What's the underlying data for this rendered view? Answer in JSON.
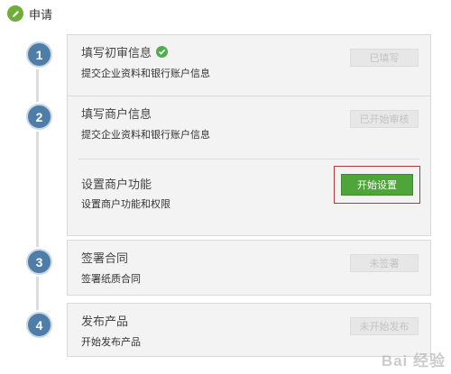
{
  "header": {
    "title": "申请",
    "icon": "pencil-icon"
  },
  "steps": [
    {
      "number": "1",
      "sections": [
        {
          "title": "填写初审信息",
          "desc": "提交企业资料和银行账户信息",
          "button": "已填写",
          "done": true
        }
      ]
    },
    {
      "number": "2",
      "sections": [
        {
          "title": "填写商户信息",
          "desc": "提交企业资料和银行账户信息",
          "button": "已开始审核"
        },
        {
          "title": "设置商户功能",
          "desc": "设置商户功能和权限",
          "button": "开始设置",
          "primary": true
        }
      ]
    },
    {
      "number": "3",
      "sections": [
        {
          "title": "签署合同",
          "desc": "签署纸质合同",
          "button": "未签署"
        }
      ]
    },
    {
      "number": "4",
      "sections": [
        {
          "title": "发布产品",
          "desc": "开始发布产品",
          "button": "未开始发布"
        }
      ]
    }
  ],
  "colors": {
    "step_circle": "#4e7ea8",
    "primary_button": "#4fa53a",
    "highlight_border": "#b23a3a",
    "check": "#4cae4c"
  },
  "watermark": "Bai 经验"
}
